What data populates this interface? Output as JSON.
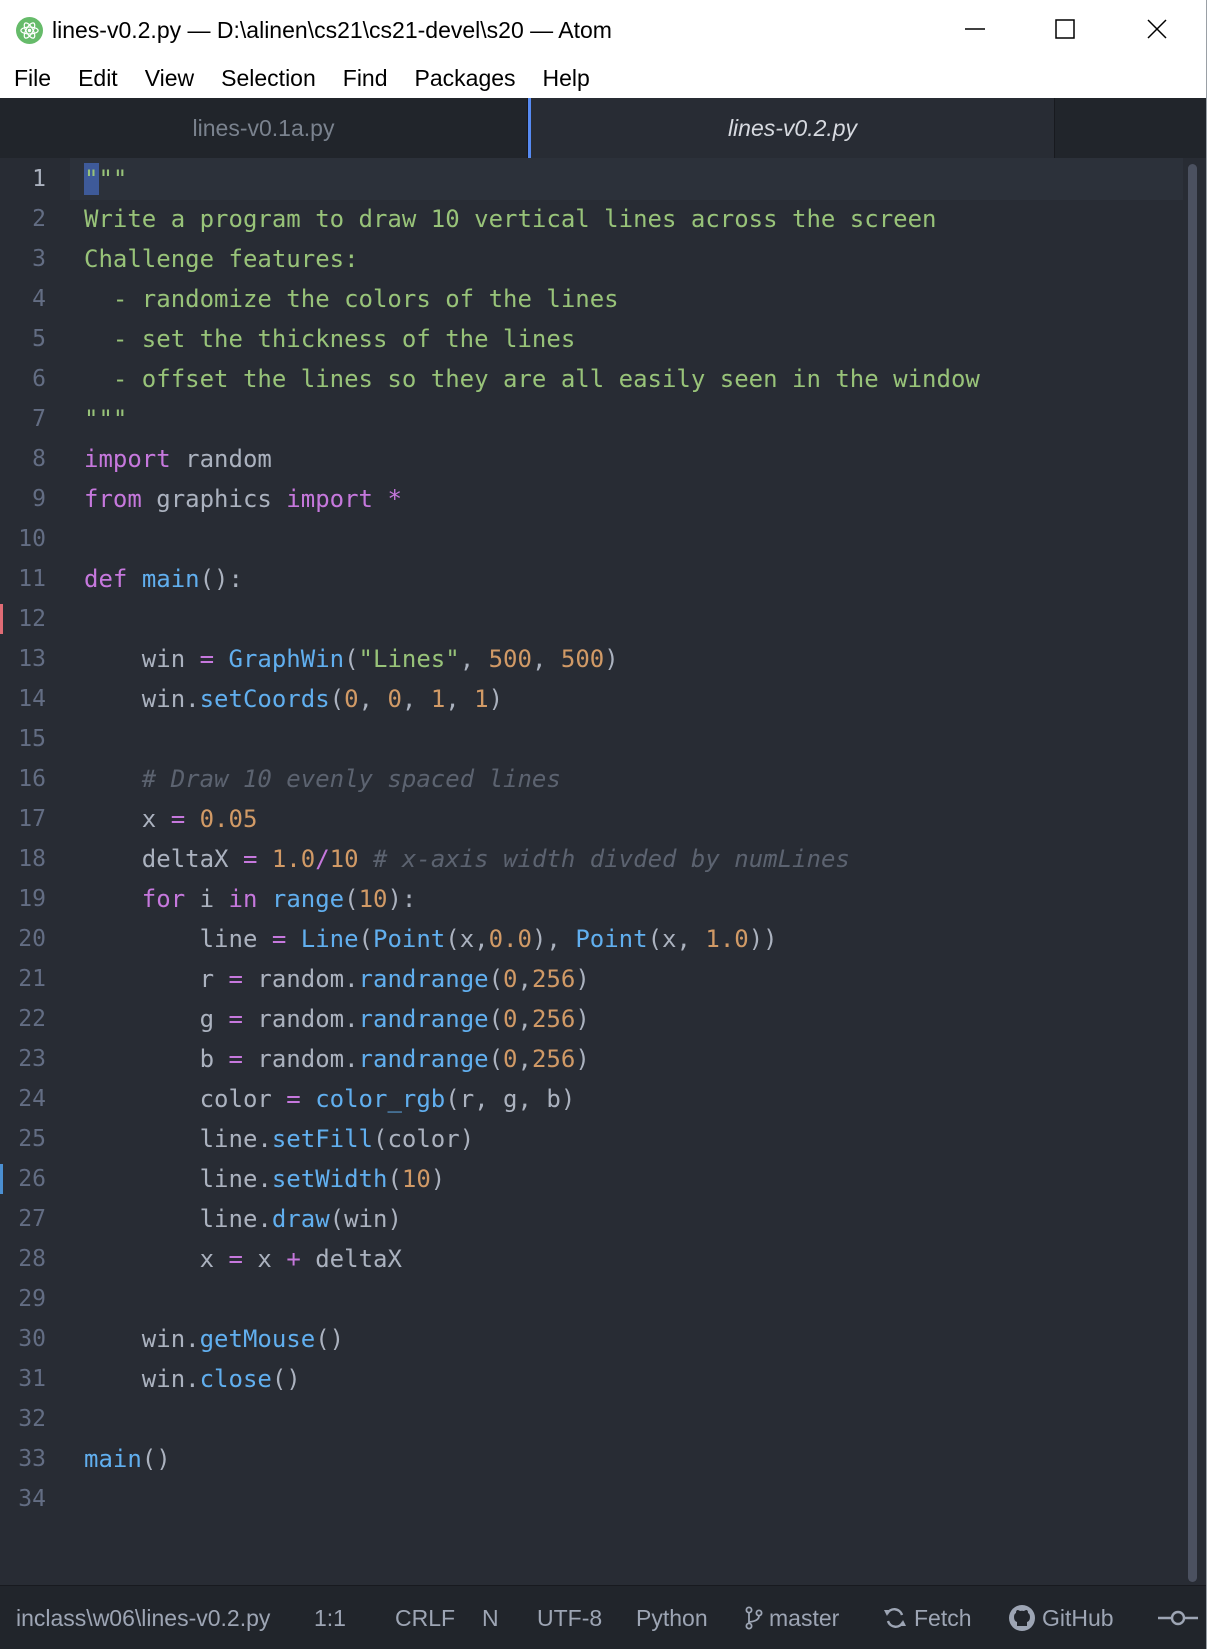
{
  "window": {
    "title": "lines-v0.2.py — D:\\alinen\\cs21\\cs21-devel\\s20 — Atom",
    "icon": "atom-icon"
  },
  "menu": [
    "File",
    "Edit",
    "View",
    "Selection",
    "Find",
    "Packages",
    "Help"
  ],
  "tabs": [
    {
      "label": "lines-v0.1a.py",
      "active": false
    },
    {
      "label": "lines-v0.2.py",
      "active": true
    }
  ],
  "editor": {
    "line_numbers": [
      "1",
      "2",
      "3",
      "4",
      "5",
      "6",
      "7",
      "8",
      "9",
      "10",
      "11",
      "12",
      "13",
      "14",
      "15",
      "16",
      "17",
      "18",
      "19",
      "20",
      "21",
      "22",
      "23",
      "24",
      "25",
      "26",
      "27",
      "28",
      "29",
      "30",
      "31",
      "32",
      "33",
      "34"
    ],
    "lines": [
      [
        [
          "s",
          "\"\"\""
        ]
      ],
      [
        [
          "s",
          "Write a program to draw 10 vertical lines across the screen"
        ]
      ],
      [
        [
          "s",
          "Challenge features:"
        ]
      ],
      [
        [
          "s",
          "  - randomize the colors of the lines"
        ]
      ],
      [
        [
          "s",
          "  - set the thickness of the lines"
        ]
      ],
      [
        [
          "s",
          "  - offset the lines so they are all easily seen in the window"
        ]
      ],
      [
        [
          "s",
          "\"\"\""
        ]
      ],
      [
        [
          "k",
          "import"
        ],
        [
          "t",
          " random"
        ]
      ],
      [
        [
          "k",
          "from"
        ],
        [
          "t",
          " graphics "
        ],
        [
          "k",
          "import"
        ],
        [
          "t",
          " "
        ],
        [
          "o",
          "*"
        ]
      ],
      [],
      [
        [
          "k",
          "def"
        ],
        [
          "t",
          " "
        ],
        [
          "f",
          "main"
        ],
        [
          "t",
          "():"
        ]
      ],
      [],
      [
        [
          "t",
          "    win "
        ],
        [
          "o",
          "="
        ],
        [
          "t",
          " "
        ],
        [
          "f",
          "GraphWin"
        ],
        [
          "t",
          "("
        ],
        [
          "s",
          "\"Lines\""
        ],
        [
          "t",
          ", "
        ],
        [
          "n",
          "500"
        ],
        [
          "t",
          ", "
        ],
        [
          "n",
          "500"
        ],
        [
          "t",
          ")"
        ]
      ],
      [
        [
          "t",
          "    win."
        ],
        [
          "f",
          "setCoords"
        ],
        [
          "t",
          "("
        ],
        [
          "n",
          "0"
        ],
        [
          "t",
          ", "
        ],
        [
          "n",
          "0"
        ],
        [
          "t",
          ", "
        ],
        [
          "n",
          "1"
        ],
        [
          "t",
          ", "
        ],
        [
          "n",
          "1"
        ],
        [
          "t",
          ")"
        ]
      ],
      [],
      [
        [
          "c",
          "    # Draw 10 evenly spaced lines"
        ]
      ],
      [
        [
          "t",
          "    x "
        ],
        [
          "o",
          "="
        ],
        [
          "t",
          " "
        ],
        [
          "n",
          "0.05"
        ]
      ],
      [
        [
          "t",
          "    deltaX "
        ],
        [
          "o",
          "="
        ],
        [
          "t",
          " "
        ],
        [
          "n",
          "1.0"
        ],
        [
          "o",
          "/"
        ],
        [
          "n",
          "10"
        ],
        [
          "t",
          " "
        ],
        [
          "c",
          "# x-axis width divded by numLines"
        ]
      ],
      [
        [
          "t",
          "    "
        ],
        [
          "k",
          "for"
        ],
        [
          "t",
          " i "
        ],
        [
          "k",
          "in"
        ],
        [
          "t",
          " "
        ],
        [
          "f",
          "range"
        ],
        [
          "t",
          "("
        ],
        [
          "n",
          "10"
        ],
        [
          "t",
          "):"
        ]
      ],
      [
        [
          "t",
          "        line "
        ],
        [
          "o",
          "="
        ],
        [
          "t",
          " "
        ],
        [
          "f",
          "Line"
        ],
        [
          "t",
          "("
        ],
        [
          "f",
          "Point"
        ],
        [
          "t",
          "(x,"
        ],
        [
          "n",
          "0.0"
        ],
        [
          "t",
          "), "
        ],
        [
          "f",
          "Point"
        ],
        [
          "t",
          "(x, "
        ],
        [
          "n",
          "1.0"
        ],
        [
          "t",
          "))"
        ]
      ],
      [
        [
          "t",
          "        r "
        ],
        [
          "o",
          "="
        ],
        [
          "t",
          " random."
        ],
        [
          "f",
          "randrange"
        ],
        [
          "t",
          "("
        ],
        [
          "n",
          "0"
        ],
        [
          "t",
          ","
        ],
        [
          "n",
          "256"
        ],
        [
          "t",
          ")"
        ]
      ],
      [
        [
          "t",
          "        g "
        ],
        [
          "o",
          "="
        ],
        [
          "t",
          " random."
        ],
        [
          "f",
          "randrange"
        ],
        [
          "t",
          "("
        ],
        [
          "n",
          "0"
        ],
        [
          "t",
          ","
        ],
        [
          "n",
          "256"
        ],
        [
          "t",
          ")"
        ]
      ],
      [
        [
          "t",
          "        b "
        ],
        [
          "o",
          "="
        ],
        [
          "t",
          " random."
        ],
        [
          "f",
          "randrange"
        ],
        [
          "t",
          "("
        ],
        [
          "n",
          "0"
        ],
        [
          "t",
          ","
        ],
        [
          "n",
          "256"
        ],
        [
          "t",
          ")"
        ]
      ],
      [
        [
          "t",
          "        color "
        ],
        [
          "o",
          "="
        ],
        [
          "t",
          " "
        ],
        [
          "f",
          "color_rgb"
        ],
        [
          "t",
          "(r, g, b)"
        ]
      ],
      [
        [
          "t",
          "        line."
        ],
        [
          "f",
          "setFill"
        ],
        [
          "t",
          "(color)"
        ]
      ],
      [
        [
          "t",
          "        line."
        ],
        [
          "f",
          "setWidth"
        ],
        [
          "t",
          "("
        ],
        [
          "n",
          "10"
        ],
        [
          "t",
          ")"
        ]
      ],
      [
        [
          "t",
          "        line."
        ],
        [
          "f",
          "draw"
        ],
        [
          "t",
          "(win)"
        ]
      ],
      [
        [
          "t",
          "        x "
        ],
        [
          "o",
          "="
        ],
        [
          "t",
          " x "
        ],
        [
          "o",
          "+"
        ],
        [
          "t",
          " deltaX"
        ]
      ],
      [],
      [
        [
          "t",
          "    win."
        ],
        [
          "f",
          "getMouse"
        ],
        [
          "t",
          "()"
        ]
      ],
      [
        [
          "t",
          "    win."
        ],
        [
          "f",
          "close"
        ],
        [
          "t",
          "()"
        ]
      ],
      [],
      [
        [
          "f",
          "main"
        ],
        [
          "t",
          "()"
        ]
      ],
      []
    ]
  },
  "status": {
    "path": "inclass\\w06\\lines-v0.2.py",
    "cursor": "1:1",
    "line_ending": "CRLF",
    "indicator": "N",
    "encoding": "UTF-8",
    "grammar": "Python",
    "branch": "master",
    "fetch": "Fetch",
    "github": "GitHub"
  },
  "colors": {
    "editor_bg": "#282c34",
    "string": "#98c379",
    "keyword": "#c678dd",
    "function": "#61afef",
    "number": "#d19a66",
    "comment": "#5c6370",
    "tab_accent": "#568af2"
  }
}
